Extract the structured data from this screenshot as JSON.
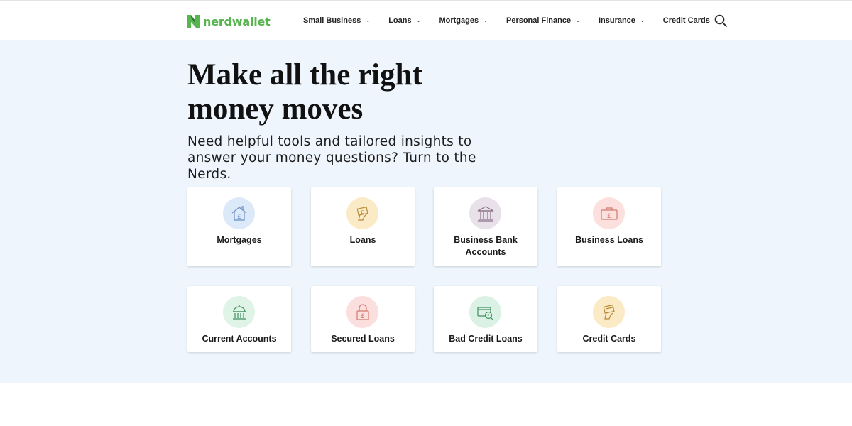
{
  "header": {
    "logo_text": "nerdwallet",
    "nav": [
      {
        "label": "Small Business"
      },
      {
        "label": "Loans"
      },
      {
        "label": "Mortgages"
      },
      {
        "label": "Personal Finance"
      },
      {
        "label": "Insurance"
      },
      {
        "label": "Credit Cards"
      }
    ]
  },
  "hero": {
    "headline": "Make all the right money moves",
    "subhead": "Need helpful tools and tailored insights to answer your money questions? Turn to the Nerds."
  },
  "cards": [
    {
      "label": "Mortgages",
      "icon": "house-pound-icon",
      "circle_color": "#dce9f8"
    },
    {
      "label": "Loans",
      "icon": "hand-cash-icon",
      "circle_color": "#fbeac6"
    },
    {
      "label": "Business Bank Accounts",
      "icon": "bank-icon",
      "circle_color": "#e8e1e9"
    },
    {
      "label": "Business Loans",
      "icon": "briefcase-pound-icon",
      "circle_color": "#fbe0de"
    },
    {
      "label": "Current Accounts",
      "icon": "bank-dome-icon",
      "circle_color": "#dff3e6"
    },
    {
      "label": "Secured Loans",
      "icon": "padlock-pound-icon",
      "circle_color": "#fbdede"
    },
    {
      "label": "Bad Credit Loans",
      "icon": "card-search-icon",
      "circle_color": "#dcf1e6"
    },
    {
      "label": "Credit Cards",
      "icon": "hand-card-icon",
      "circle_color": "#fbeac6"
    }
  ],
  "colors": {
    "brand_green": "#57b54f",
    "hero_background": "#eef5fd"
  }
}
